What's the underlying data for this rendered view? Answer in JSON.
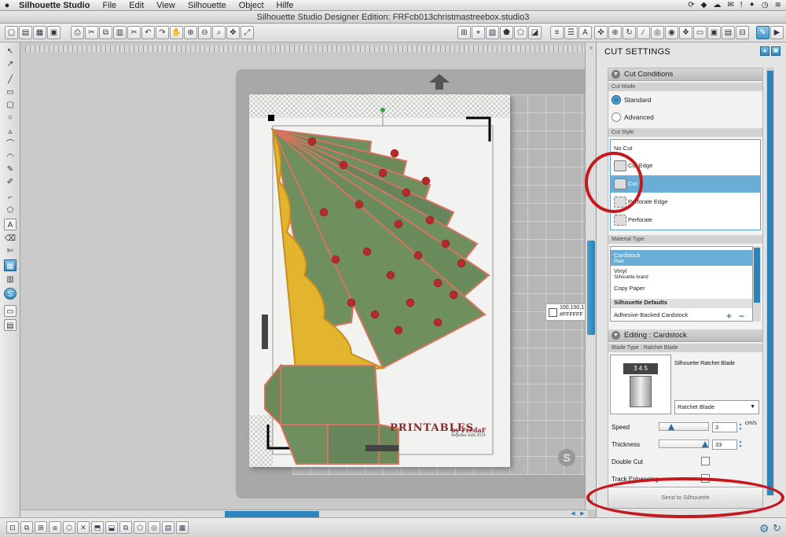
{
  "menubar": {
    "apple": "",
    "items": [
      "Silhouette Studio",
      "File",
      "Edit",
      "View",
      "Silhouette",
      "Object",
      "Hilfe"
    ]
  },
  "window": {
    "title": "Silhouette Studio Designer Edition: FRFcb013christmastreebox.studio3"
  },
  "canvas": {
    "color_readout_line1": "100,100,1",
    "color_readout_line2": "#FFFFFF",
    "watermark_title": "PRINTABLES",
    "watermark_by": "by FredaF",
    "watermark_sub": "Angelika Gelb 2014",
    "logo_letter": "S"
  },
  "panel": {
    "title": "CUT SETTINGS",
    "cut_conditions": {
      "header": "Cut Conditions",
      "mode_label": "Cut Mode",
      "modes": [
        {
          "label": "Standard",
          "selected": true
        },
        {
          "label": "Advanced",
          "selected": false
        }
      ],
      "style_label": "Cut Style",
      "styles": [
        {
          "label": "No Cut",
          "selected": false
        },
        {
          "label": "Cut Edge",
          "selected": false
        },
        {
          "label": "Cut",
          "selected": true
        },
        {
          "label": "Perforate Edge",
          "selected": false
        },
        {
          "label": "Perforate",
          "selected": false
        }
      ],
      "material_label": "Material Type",
      "materials": [
        {
          "label": "Cardstock",
          "sub": "Plain",
          "selected": true
        },
        {
          "label": "Vinyl",
          "sub": "Silhouette brand",
          "selected": false
        },
        {
          "label": "Copy Paper",
          "sub": "",
          "selected": false
        },
        {
          "label": "Silhouette Defaults",
          "sub": "",
          "selected": false
        },
        {
          "label": "Adhesive-Backed Cardstock",
          "sub": "",
          "selected": false
        }
      ],
      "add_btn": "+",
      "remove_btn": "−"
    },
    "editing": {
      "header": "Editing : Cardstock",
      "blade_type_label": "Blade Type : Ratchet Blade",
      "blade_name": "Silhouette Ratchet Blade",
      "blade_numbers": "3 4 5",
      "blade_select": "Ratchet Blade",
      "speed_label": "Speed",
      "speed_value": "3",
      "speed_unit": "cm/s",
      "speed_level": 0.2,
      "thickness_label": "Thickness",
      "thickness_value": "33",
      "thickness_level": 0.97,
      "double_cut_label": "Double Cut",
      "track_label": "Track Enhancing"
    },
    "send_button": "Send to Silhouette"
  },
  "colors": {
    "accent": "#2f86bd",
    "annotation": "#c4191f",
    "tree_green": "#6f8f5e",
    "ornament_red": "#b72a2a",
    "scallop_yellow": "#e3b52e"
  }
}
